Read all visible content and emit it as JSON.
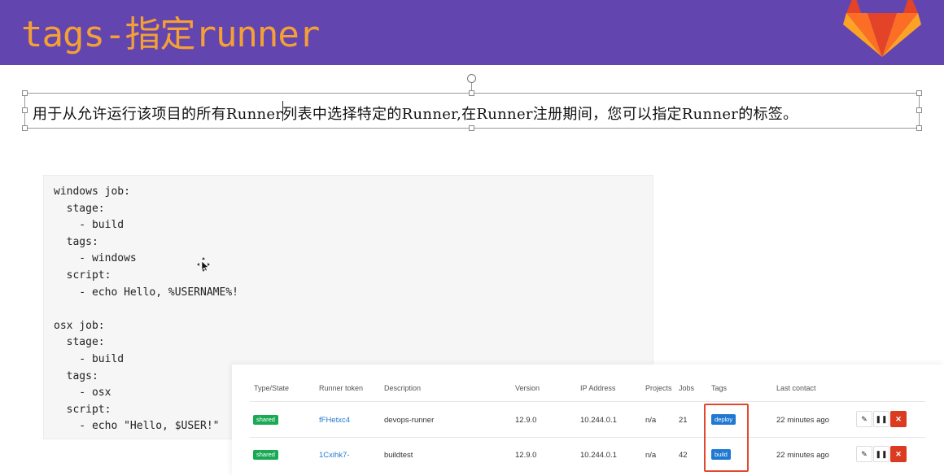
{
  "header": {
    "title": "tags-指定runner"
  },
  "intro": {
    "text": "用于从允许运行该项目的所有Runner列表中选择特定的Runner,在Runner注册期间，您可以指定Runner的标签。"
  },
  "code": {
    "lines": [
      "windows job:",
      "  stage:",
      "    - build",
      "  tags:",
      "    - windows",
      "  script:",
      "    - echo Hello, %USERNAME%!",
      "",
      "osx job:",
      "  stage:",
      "    - build",
      "  tags:",
      "    - osx",
      "  script:",
      "    - echo \"Hello, $USER!\""
    ]
  },
  "runners_table": {
    "headers": [
      "Type/State",
      "Runner token",
      "Description",
      "Version",
      "IP Address",
      "Projects",
      "Jobs",
      "Tags",
      "Last contact"
    ],
    "rows": [
      {
        "type": "shared",
        "token": "fFHetxc4",
        "description": "devops-runner",
        "version": "12.9.0",
        "ip": "10.244.0.1",
        "projects": "n/a",
        "jobs": "21",
        "tag": "deploy",
        "last_contact": "22 minutes ago"
      },
      {
        "type": "shared",
        "token": "1Cxihk7-",
        "description": "buildtest",
        "version": "12.9.0",
        "ip": "10.244.0.1",
        "projects": "n/a",
        "jobs": "42",
        "tag": "build",
        "last_contact": "22 minutes ago"
      }
    ],
    "actions": {
      "edit": "✎",
      "pause": "❚❚",
      "remove": "✕"
    }
  },
  "colors": {
    "header_bg": "#6345b0",
    "title": "#f5a033",
    "shared": "#1aaa55",
    "tag": "#1f78d1",
    "danger": "#db3b21",
    "highlight": "#e2472f"
  },
  "icons": {
    "logo": "gitlab-fox-icon",
    "cursor": "move-cursor-icon",
    "rotate": "rotate-handle-icon"
  }
}
